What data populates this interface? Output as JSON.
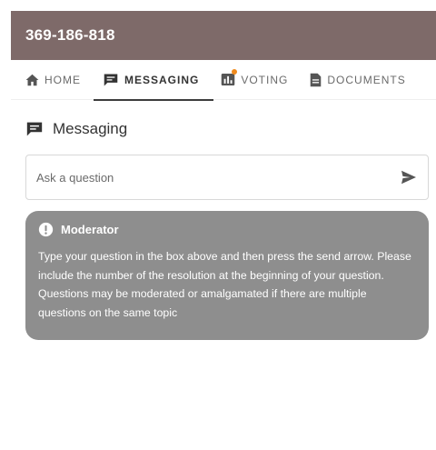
{
  "header": {
    "meeting_id": "369-186-818"
  },
  "tabs": [
    {
      "label": "HOME",
      "icon": "home-icon",
      "active": false
    },
    {
      "label": "MESSAGING",
      "icon": "chat-icon",
      "active": true
    },
    {
      "label": "VOTING",
      "icon": "bar-chart-icon",
      "active": false,
      "notification": true
    },
    {
      "label": "DOCUMENTS",
      "icon": "document-icon",
      "active": false
    }
  ],
  "messaging": {
    "title": "Messaging",
    "icon": "chat-icon",
    "input": {
      "placeholder": "Ask a question",
      "value": ""
    },
    "send_icon": "send-icon"
  },
  "moderator": {
    "title": "Moderator",
    "icon": "info-icon",
    "message": "Type your question in the box above and then press the send arrow. Please include the number of the resolution at the beginning of your question. Questions may be moderated or amalgamated if there are multiple questions on the same topic"
  },
  "colors": {
    "header_bg": "#7e6a69",
    "moderator_bg": "#8e8e8e",
    "notification_dot": "#f08a1c"
  }
}
